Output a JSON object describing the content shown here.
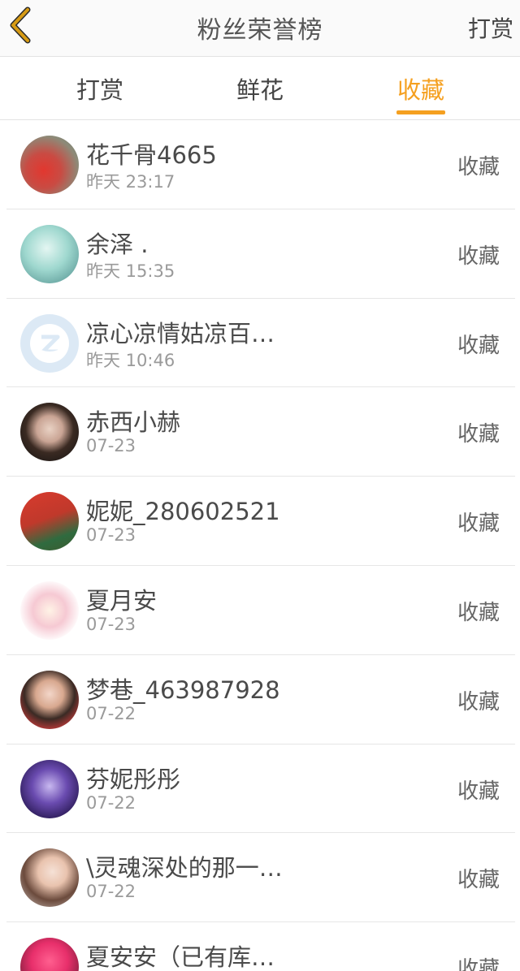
{
  "header": {
    "title": "粉丝荣誉榜",
    "action_label": "打赏"
  },
  "tabs": [
    {
      "label": "打赏",
      "active": false
    },
    {
      "label": "鲜花",
      "active": false
    },
    {
      "label": "收藏",
      "active": true
    }
  ],
  "colors": {
    "accent": "#f5a020",
    "back_icon": "#d79b14"
  },
  "fans": [
    {
      "name": "花千骨4665",
      "time": "昨天 23:17",
      "action": "收藏"
    },
    {
      "name": "余泽 .",
      "time": "昨天 15:35",
      "action": "收藏"
    },
    {
      "name": "凉心凉情姑凉百…",
      "time": "昨天 10:46",
      "action": "收藏"
    },
    {
      "name": "赤西小赫",
      "time": "07-23",
      "action": "收藏"
    },
    {
      "name": "妮妮_280602521",
      "time": "07-23",
      "action": "收藏"
    },
    {
      "name": "夏月安",
      "time": "07-23",
      "action": "收藏"
    },
    {
      "name": "梦巷_463987928",
      "time": "07-22",
      "action": "收藏"
    },
    {
      "name": "芬妮彤彤",
      "time": "07-22",
      "action": "收藏"
    },
    {
      "name": "\\灵魂深处的那一…",
      "time": "07-22",
      "action": "收藏"
    },
    {
      "name": "夏安安（已有库…",
      "time": "",
      "action": "收藏"
    }
  ]
}
